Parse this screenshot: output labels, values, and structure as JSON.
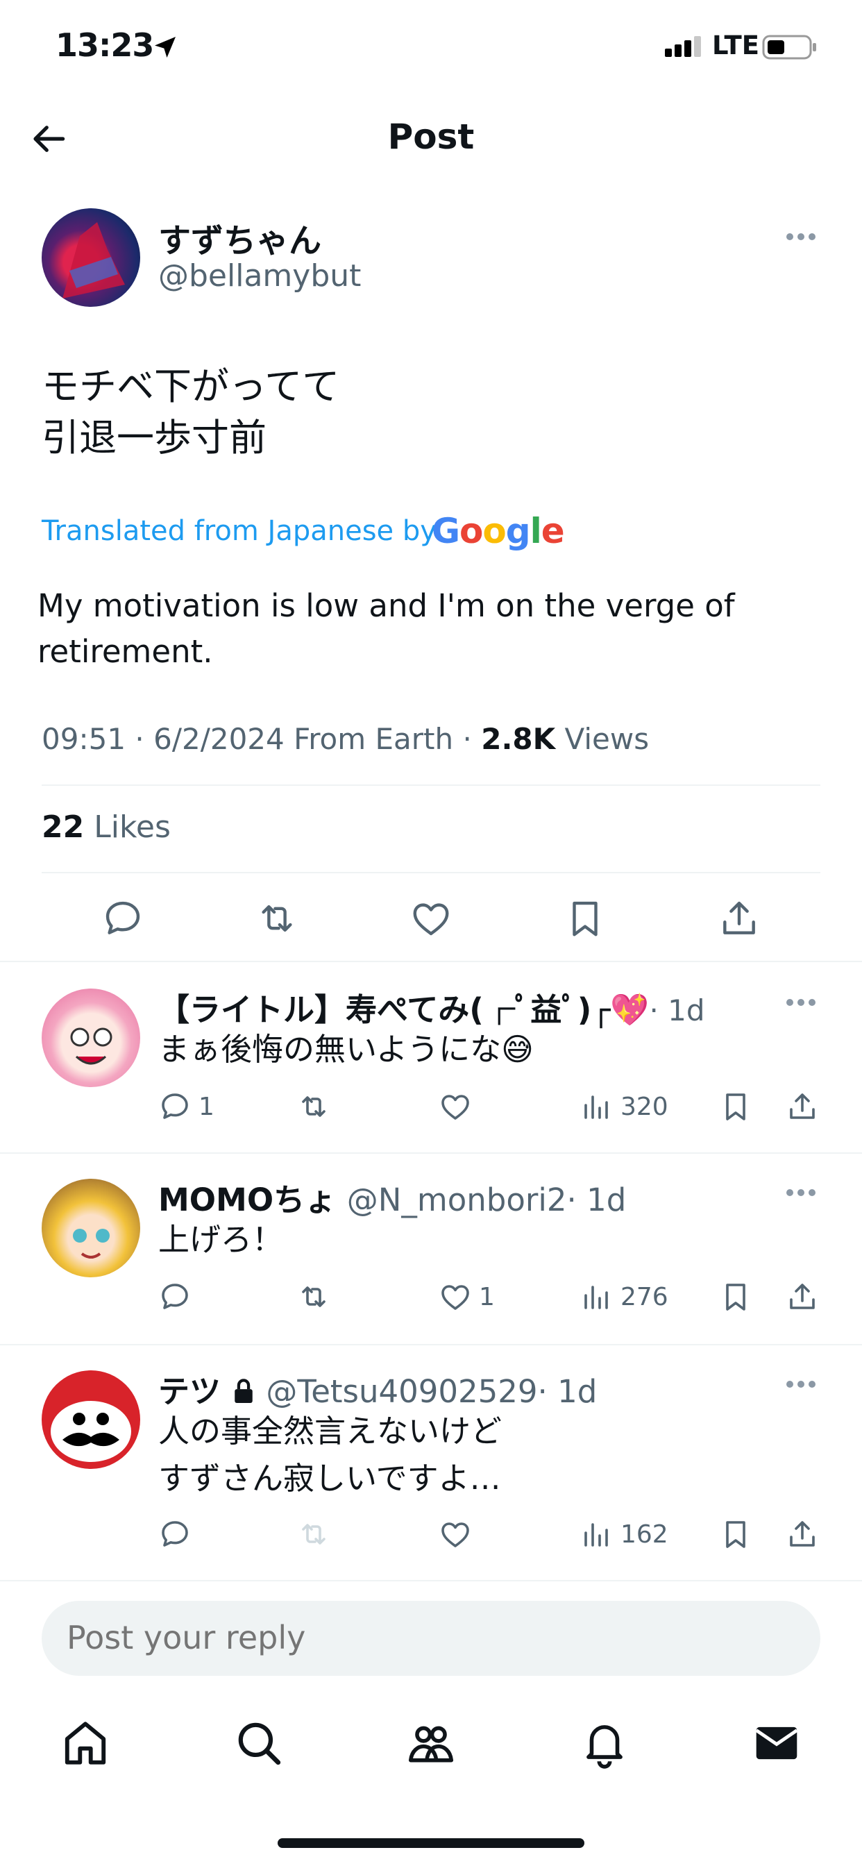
{
  "status_bar": {
    "time": "13:23",
    "network": "LTE"
  },
  "header": {
    "title": "Post"
  },
  "post": {
    "author_name": "すずちゃん",
    "author_handle": "@bellamybut",
    "original_text": "モチベ下がってて\n引退一歩寸前",
    "translated_label": "Translated from Japanese by",
    "translator_brand": "Google",
    "translation": "My motivation is low and I'm on the verge of retirement.",
    "time": "09:51",
    "date": "6/2/2024",
    "location": "From Earth",
    "views_count": "2.8K",
    "views_label": "Views",
    "likes_count": "22",
    "likes_label": "Likes"
  },
  "replies": [
    {
      "name": "【ライトル】寿ぺてみ(┌ﾟ益ﾟ)┌💖",
      "handle": "",
      "age": "· 1d",
      "text": "まぁ後悔の無いようにな😅",
      "reply_count": "1",
      "like_count": "",
      "view_count": "320"
    },
    {
      "name": "MOMOちょ",
      "handle": "@N_monbori2",
      "age": "· 1d",
      "text": "上げろ！",
      "reply_count": "",
      "like_count": "1",
      "view_count": "276"
    },
    {
      "name": "テツ",
      "handle": "@Tetsu40902529",
      "age": "· 1d",
      "text": "人の事全然言えないけど\nすずさん寂しいですよ…",
      "reply_count": "",
      "like_count": "",
      "view_count": "162"
    }
  ],
  "reply_box": {
    "placeholder": "Post your reply"
  },
  "tab_bar": [
    "home-icon",
    "search-icon",
    "communities-icon",
    "notifications-icon",
    "messages-icon"
  ],
  "colors": {
    "accent": "#1d9bf0",
    "text": "#0f1419",
    "muted": "#536471",
    "divider": "#eff3f4"
  }
}
